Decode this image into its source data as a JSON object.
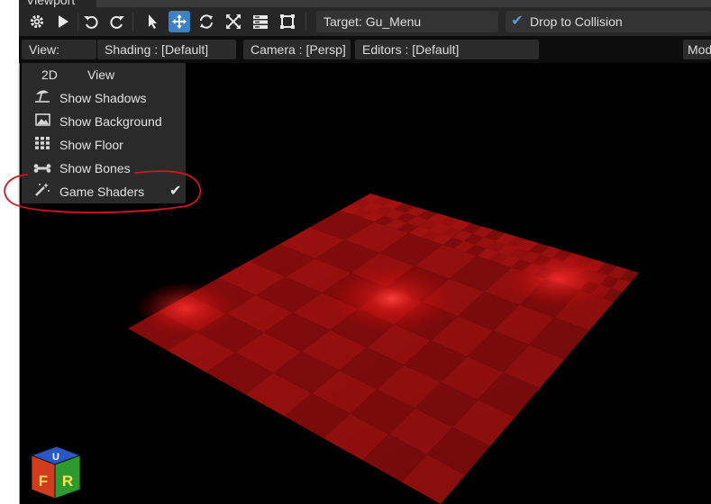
{
  "window": {
    "tab_title": "Viewport"
  },
  "toolbar": {
    "icons": [
      "gear-icon",
      "play-icon",
      "undo-icon",
      "redo-icon",
      "select-arrow-icon",
      "move-icon",
      "rotate-icon",
      "scale-icon",
      "layers-icon",
      "transform-box-icon"
    ],
    "active_tool": "move-icon",
    "target_label": "Target: Gu_Menu",
    "drop_checked": true,
    "drop_label": "Drop to Collision",
    "accent_color": "#3b82c4"
  },
  "menubar": {
    "view": "View:",
    "shading": "Shading : [Default]",
    "camera": "Camera : [Persp]",
    "editors": "Editors : [Default]",
    "mode": "Mod"
  },
  "view_menu": {
    "header_a": "2D",
    "header_b": "View",
    "items": [
      {
        "icon": "beach-umbrella-icon",
        "label": "Show Shadows",
        "checked": false
      },
      {
        "icon": "image-icon",
        "label": "Show Background",
        "checked": false
      },
      {
        "icon": "grid-icon",
        "label": "Show Floor",
        "checked": false
      },
      {
        "icon": "bone-icon",
        "label": "Show Bones",
        "checked": false
      },
      {
        "icon": "magic-wand-icon",
        "label": "Game Shaders",
        "checked": true
      }
    ]
  },
  "gizmo": {
    "faces": [
      "U",
      "F",
      "R"
    ],
    "colors": [
      "#2a56c8",
      "#d23c1e",
      "#2c9a2c"
    ]
  },
  "floor_color": "#a01010",
  "annotation_color": "#d0161c"
}
